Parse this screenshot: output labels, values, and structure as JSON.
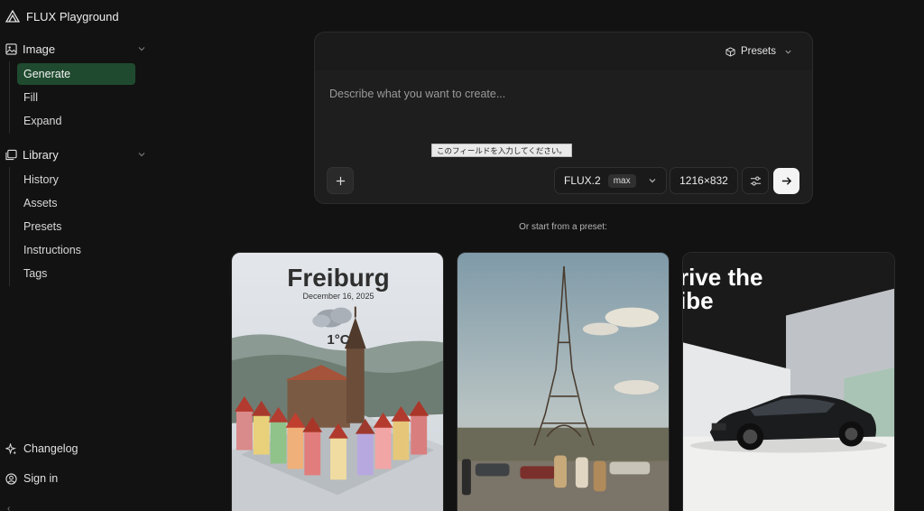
{
  "app": {
    "title": "FLUX Playground"
  },
  "sidebar": {
    "image_section": {
      "label": "Image",
      "items": [
        {
          "label": "Generate",
          "active": true
        },
        {
          "label": "Fill"
        },
        {
          "label": "Expand"
        }
      ]
    },
    "library_section": {
      "label": "Library",
      "items": [
        {
          "label": "History"
        },
        {
          "label": "Assets"
        },
        {
          "label": "Presets"
        },
        {
          "label": "Instructions"
        },
        {
          "label": "Tags"
        }
      ]
    },
    "footer": {
      "changelog": "Changelog",
      "sign_in": "Sign in"
    }
  },
  "prompt": {
    "presets_label": "Presets",
    "placeholder": "Describe what you want to create...",
    "value": "",
    "validation_tooltip": "このフィールドを入力してください。",
    "model_name": "FLUX.2",
    "model_variant": "max",
    "size": "1216×832"
  },
  "presets_section": {
    "heading": "Or start from a preset:",
    "cards": [
      {
        "title": "Freiburg",
        "date": "December 16, 2025",
        "temperature": "1°C"
      },
      {},
      {
        "headline": "rive the\nibe"
      }
    ]
  },
  "colors": {
    "background": "#121212",
    "card": "#1e1e1e",
    "active_nav": "#1f4a2f",
    "submit": "#f4f4f4"
  },
  "icons": {
    "brand": "flux-logo-icon",
    "image": "image-icon",
    "library": "library-icon",
    "chevron": "chevron-down-icon",
    "presets": "cube-icon",
    "add": "plus-icon",
    "settings": "sliders-icon",
    "submit": "arrow-right-icon",
    "changelog": "sparkle-icon",
    "sign_in": "user-circle-icon"
  }
}
